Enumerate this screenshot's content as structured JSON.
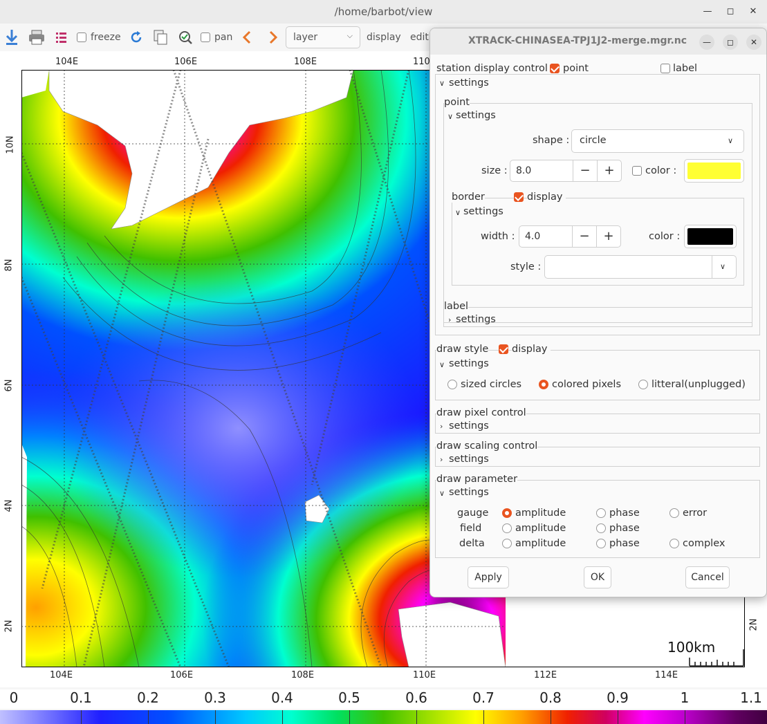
{
  "window": {
    "title": "/home/barbot/view"
  },
  "toolbar": {
    "freeze_label": "freeze",
    "pan_label": "pan",
    "layer_value": "layer",
    "display_label": "display",
    "edit_label": "editi"
  },
  "map": {
    "top_lon_labels": [
      "104E",
      "106E",
      "108E",
      "110"
    ],
    "bottom_lon_labels": [
      "104E",
      "106E",
      "108E",
      "110E",
      "112E",
      "114E"
    ],
    "left_lat_labels": [
      "10N",
      "8N",
      "6N",
      "4N",
      "2N"
    ],
    "right_lat_labels": [
      "2N"
    ],
    "scale_label": "100km"
  },
  "colorbar": {
    "labels": [
      "0",
      "0.1",
      "0.2",
      "0.3",
      "0.4",
      "0.5",
      "0.6",
      "0.7",
      "0.8",
      "0.9",
      "1",
      "1.1"
    ]
  },
  "dialog": {
    "title": "XTRACK-CHINASEA-TPJ1J2-merge.mgr.nc",
    "station_display_control": "station display control",
    "point_check_label": "point",
    "label_check_label": "label",
    "settings": "settings",
    "point_group": "point",
    "shape_label": "shape :",
    "shape_value": "circle",
    "size_label": "size :",
    "size_value": "8.0",
    "color_label": "color :",
    "point_color": "#ffff33",
    "border_label": "border",
    "display_label": "display",
    "width_label": "width :",
    "width_value": "4.0",
    "border_color_label": "color :",
    "border_color": "#000000",
    "style_label": "style :",
    "style_value": "",
    "label_group": "label",
    "draw_style": "draw style",
    "sized_circles": "sized circles",
    "colored_pixels": "colored pixels",
    "litteral": "litteral(unplugged)",
    "draw_pixel_control": "draw pixel control",
    "draw_scaling_control": "draw scaling control",
    "draw_parameter": "draw parameter",
    "row_gauge": "gauge",
    "row_field": "field",
    "row_delta": "delta",
    "amplitude": "amplitude",
    "phase": "phase",
    "error": "error",
    "complex": "complex",
    "apply": "Apply",
    "ok": "OK",
    "cancel": "Cancel"
  }
}
